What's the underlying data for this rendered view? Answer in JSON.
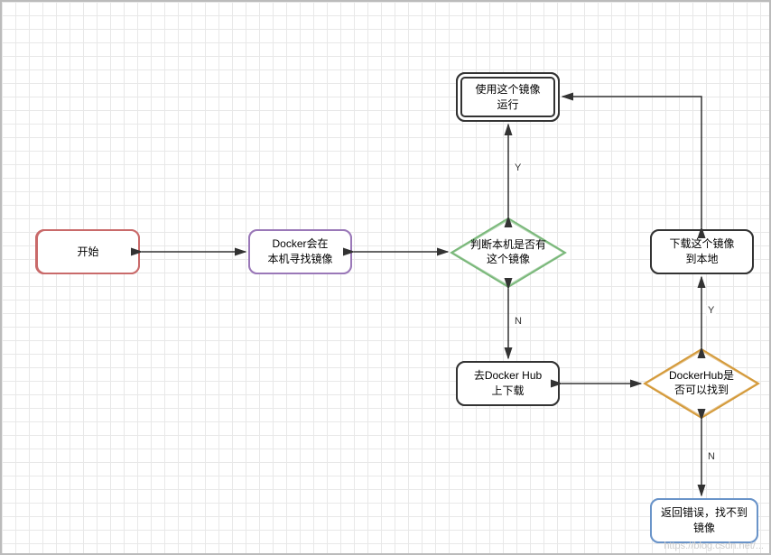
{
  "chart_data": {
    "type": "flowchart",
    "nodes": [
      {
        "id": "start",
        "label": "开始",
        "shape": "rect",
        "color": "red"
      },
      {
        "id": "local_search",
        "label": "Docker会在\n本机寻找镜像",
        "shape": "rect",
        "color": "purple"
      },
      {
        "id": "has_local",
        "label": "判断本机是否有\n这个镜像",
        "shape": "diamond",
        "color": "green"
      },
      {
        "id": "run",
        "label": "使用这个镜像\n运行",
        "shape": "rect-double",
        "color": "black"
      },
      {
        "id": "download_local",
        "label": "下载这个镜像\n到本地",
        "shape": "rect",
        "color": "black"
      },
      {
        "id": "goto_hub",
        "label": "去Docker Hub\n上下载",
        "shape": "rect",
        "color": "black"
      },
      {
        "id": "hub_found",
        "label": "DockerHub是\n否可以找到",
        "shape": "diamond",
        "color": "orange"
      },
      {
        "id": "error",
        "label": "返回错误，找不到\n镜像",
        "shape": "rect",
        "color": "blue"
      }
    ],
    "edges": [
      {
        "from": "start",
        "to": "local_search",
        "label": ""
      },
      {
        "from": "local_search",
        "to": "has_local",
        "label": ""
      },
      {
        "from": "has_local",
        "to": "run",
        "label": "Y"
      },
      {
        "from": "has_local",
        "to": "goto_hub",
        "label": "N"
      },
      {
        "from": "goto_hub",
        "to": "hub_found",
        "label": ""
      },
      {
        "from": "hub_found",
        "to": "download_local",
        "label": "Y"
      },
      {
        "from": "hub_found",
        "to": "error",
        "label": "N"
      },
      {
        "from": "download_local",
        "to": "run",
        "label": ""
      }
    ]
  },
  "labels": {
    "start": "开始",
    "local_search_l1": "Docker会在",
    "local_search_l2": "本机寻找镜像",
    "has_local_l1": "判断本机是否有",
    "has_local_l2": "这个镜像",
    "run_l1": "使用这个镜像",
    "run_l2": "运行",
    "download_l1": "下载这个镜像",
    "download_l2": "到本地",
    "goto_hub_l1": "去Docker Hub",
    "goto_hub_l2": "上下载",
    "hub_found_l1": "DockerHub是",
    "hub_found_l2": "否可以找到",
    "error_l1": "返回错误，找不到",
    "error_l2": "镜像",
    "yes": "Y",
    "no": "N"
  },
  "watermark": "https://blog.csdn.net/..."
}
